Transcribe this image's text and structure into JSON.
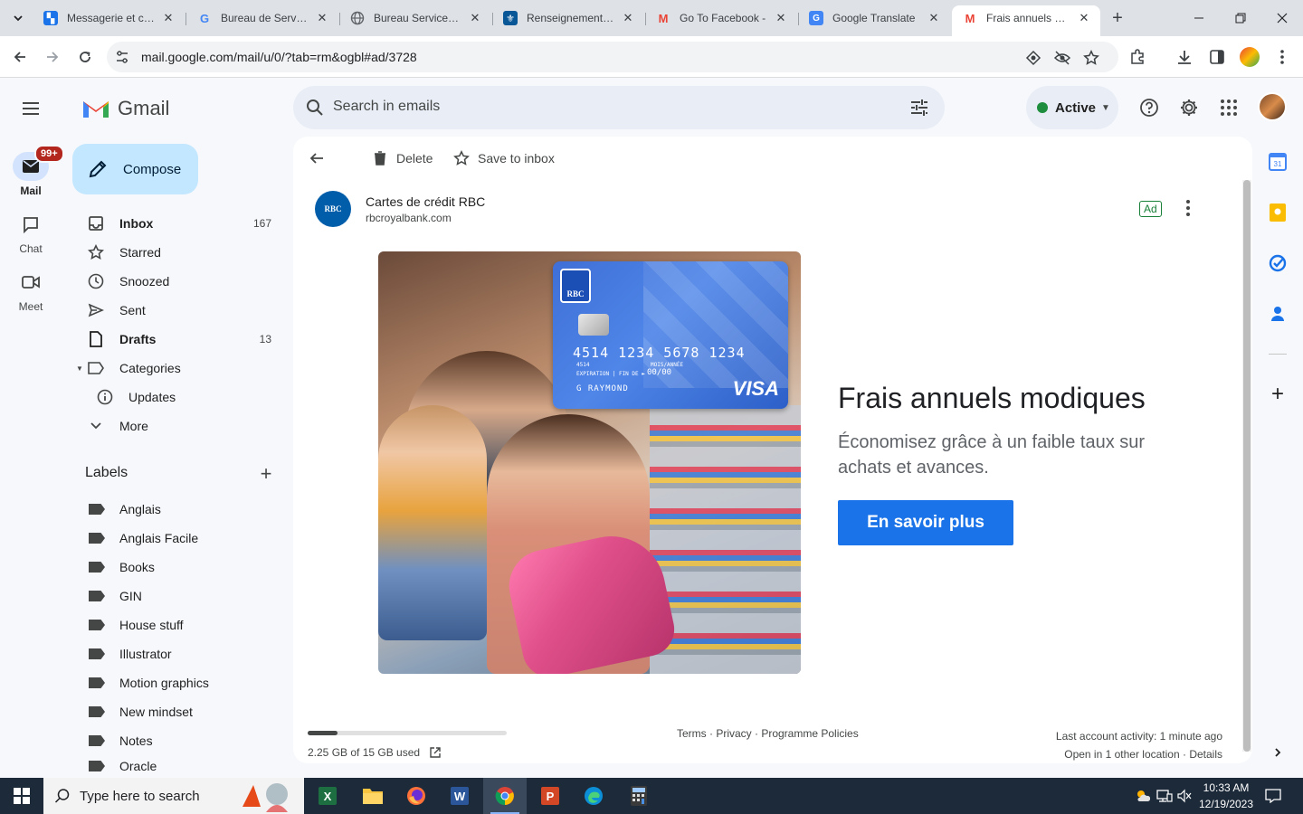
{
  "browser": {
    "tabs": [
      {
        "title": "Messagerie et cou",
        "favicon": "doc-blue"
      },
      {
        "title": "Bureau de Service",
        "favicon": "google-g"
      },
      {
        "title": "Bureau Services Q",
        "favicon": "globe"
      },
      {
        "title": "Renseignements g",
        "favicon": "fleur-de-lis"
      },
      {
        "title": "Go To Facebook - ",
        "favicon": "gmail-m"
      },
      {
        "title": "Google Translate",
        "favicon": "translate"
      },
      {
        "title": "Frais annuels mod",
        "favicon": "gmail-m"
      }
    ],
    "active_tab": 6,
    "url": "mail.google.com/mail/u/0/?tab=rm&ogbl#ad/3728"
  },
  "header": {
    "app_name": "Gmail",
    "search_placeholder": "Search in emails",
    "status": "Active"
  },
  "rail": {
    "items": [
      {
        "label": "Mail",
        "badge": "99+"
      },
      {
        "label": "Chat"
      },
      {
        "label": "Meet"
      }
    ]
  },
  "sidebar": {
    "compose": "Compose",
    "folders": [
      {
        "label": "Inbox",
        "count": "167",
        "icon": "inbox-icon"
      },
      {
        "label": "Starred",
        "count": "",
        "icon": "star-icon"
      },
      {
        "label": "Snoozed",
        "count": "",
        "icon": "clock-icon"
      },
      {
        "label": "Sent",
        "count": "",
        "icon": "send-icon"
      },
      {
        "label": "Drafts",
        "count": "13",
        "icon": "draft-icon"
      },
      {
        "label": "Categories",
        "count": "",
        "icon": "label-outline-icon"
      },
      {
        "label": "Updates",
        "count": "",
        "icon": "info-icon"
      },
      {
        "label": "More",
        "count": "",
        "icon": "chevron-down-icon"
      }
    ],
    "labels_title": "Labels",
    "labels": [
      "Anglais",
      "Anglais Facile",
      "Books",
      "GIN",
      "House stuff",
      "Illustrator",
      "Motion graphics",
      "New mindset",
      "Notes",
      "Oracle"
    ]
  },
  "message": {
    "actions": {
      "delete": "Delete",
      "save": "Save to inbox"
    },
    "sender_name": "Cartes de crédit RBC",
    "sender_domain": "rbcroyalbank.com",
    "sender_logo_text": "RBC",
    "ad_tag": "Ad",
    "card": {
      "logo": "RBC",
      "number": "4514 1234 5678 1234",
      "small_number": "4514",
      "expiry_label": "EXPIRATION | FIN DE ►",
      "valid_label": "MOIS/ANNÉE",
      "expiry": "00/00",
      "holder": "G RAYMOND",
      "network": "VISA"
    },
    "headline": "Frais annuels modiques",
    "body": "Économisez grâce à un faible taux sur achats et avances.",
    "cta": "En savoir plus"
  },
  "footer": {
    "storage": "2.25 GB of 15 GB used",
    "storage_fraction": 0.15,
    "links": "Terms · Privacy · Programme Policies",
    "activity": "Last account activity: 1 minute ago",
    "other_location": "Open in 1 other location · Details"
  },
  "taskbar": {
    "search_placeholder": "Type here to search",
    "time": "10:33 AM",
    "date": "12/19/2023"
  },
  "colors": {
    "accent": "#1a73e8",
    "compose_bg": "#c2e7ff",
    "rbc_blue": "#005daa"
  }
}
